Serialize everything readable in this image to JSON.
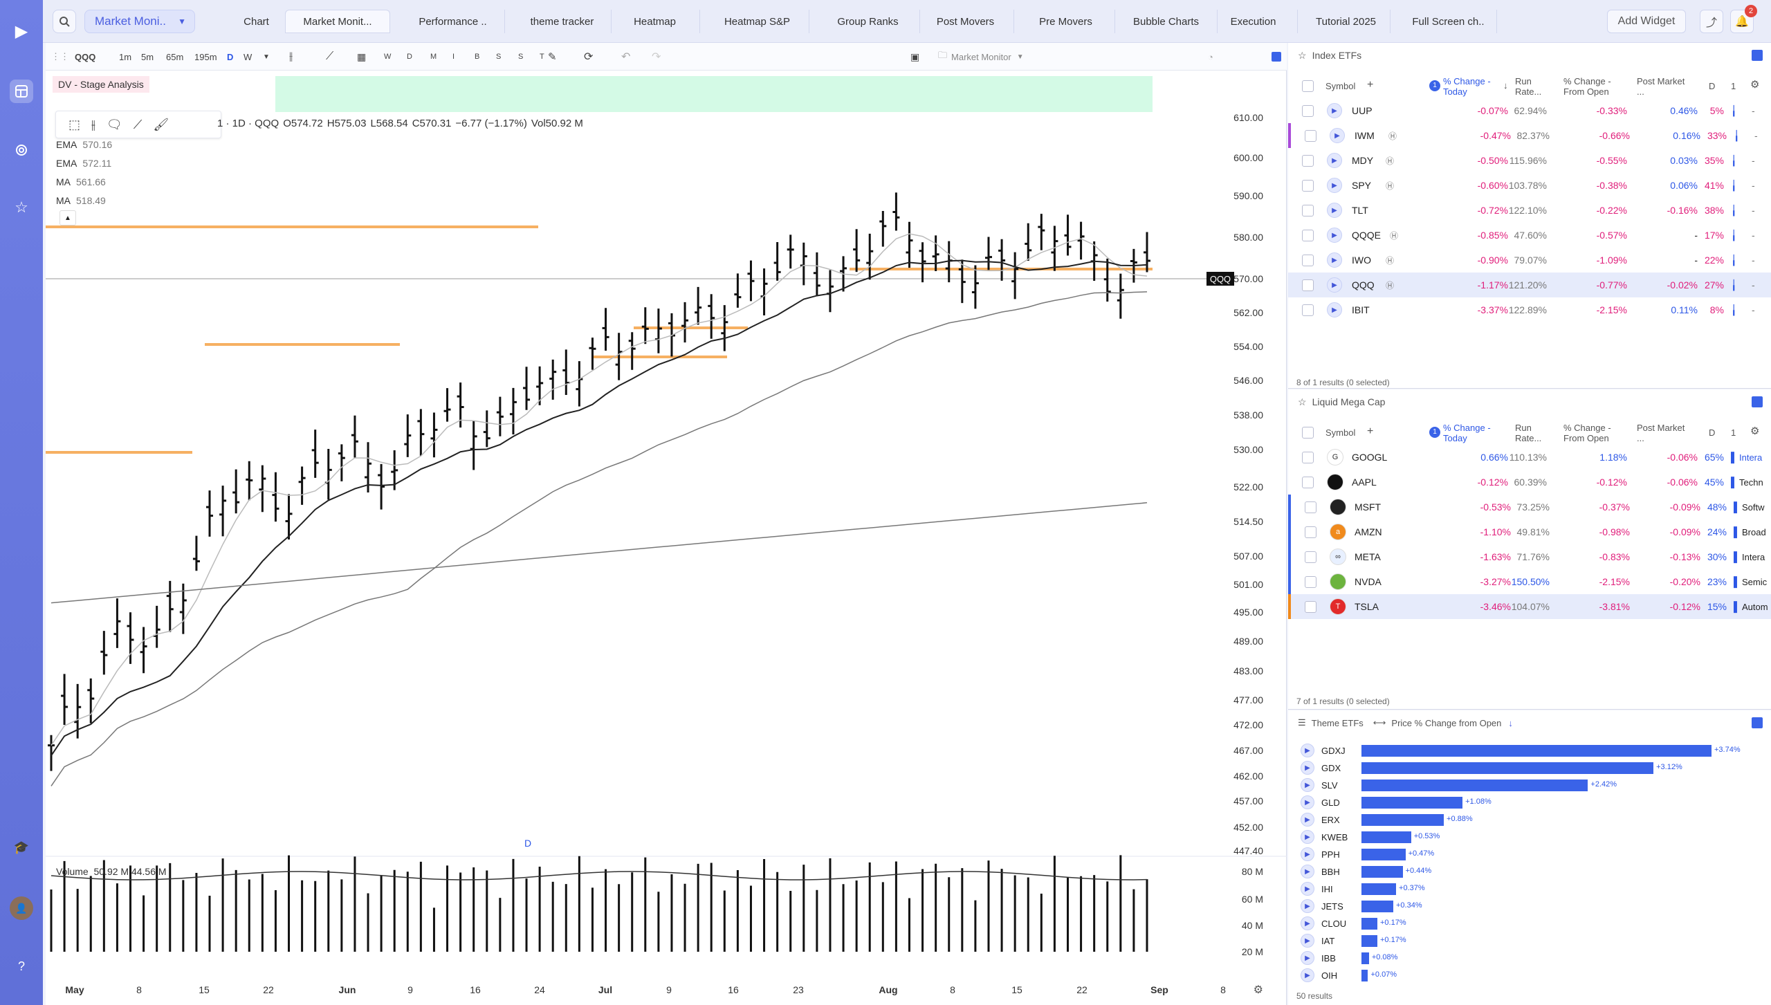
{
  "nav": {
    "workspace": "Market Moni..",
    "add_widget": "Add Widget",
    "notif_count": "2"
  },
  "tabs": [
    "Chart",
    "Market Monit...",
    "Performance ..",
    "theme tracker",
    "Heatmap",
    "Heatmap S&P",
    "Group Ranks",
    "Post Movers",
    "Pre Movers",
    "Bubble Charts",
    "Execution",
    "Tutorial 2025",
    "Full Screen ch.."
  ],
  "chart": {
    "symbol": "QQQ",
    "timeframes": [
      "1m",
      "5m",
      "65m",
      "195m",
      "D",
      "W"
    ],
    "small_btns": [
      "W",
      "D",
      "M",
      "I",
      "B",
      "S",
      "S",
      "T"
    ],
    "layout_name": "Market Monitor",
    "study_label": "DV - Stage Analysis",
    "legend_prefix": "1 · 1D · QQQ",
    "ohlc": {
      "o": "O574.72",
      "h": "H575.03",
      "l": "L568.54",
      "c": "C570.31",
      "chg": "−6.77 (−1.17%)",
      "vol": "Vol50.92 M"
    },
    "indicators": [
      {
        "name": "EMA",
        "value": "570.16"
      },
      {
        "name": "EMA",
        "value": "572.11"
      },
      {
        "name": "MA",
        "value": "561.66"
      },
      {
        "name": "MA",
        "value": "518.49"
      }
    ],
    "price_ticks": [
      "610.00",
      "600.00",
      "590.00",
      "580.00",
      "570.00",
      "562.00",
      "554.00",
      "546.00",
      "538.00",
      "530.00",
      "522.00",
      "514.50",
      "507.00",
      "501.00",
      "495.00",
      "489.00",
      "483.00",
      "477.00",
      "472.00",
      "467.00",
      "462.00",
      "457.00",
      "452.00",
      "447.40"
    ],
    "last_price": "570.00",
    "price_tag": "QQQ",
    "date_labels": [
      "May",
      "8",
      "15",
      "22",
      "Jun",
      "9",
      "16",
      "24",
      "Jul",
      "9",
      "16",
      "23",
      "Aug",
      "8",
      "15",
      "22",
      "Sep",
      "8"
    ],
    "bold_dates": [
      "May",
      "Jun",
      "Jul",
      "Aug",
      "Sep"
    ],
    "d_marker": "D",
    "volume_label": "Volume",
    "volume_vals": "50.92 M  44.56 M",
    "vol_ticks": [
      "80 M",
      "60 M",
      "40 M",
      "20 M"
    ]
  },
  "index_etfs": {
    "title": "Index ETFs",
    "headers": {
      "symbol": "Symbol",
      "change_today": "% Change - Today",
      "run_rate": "Run Rate...",
      "chg_open": "% Change - From Open",
      "post": "Post Market ...",
      "d": "D",
      "one": "1"
    },
    "rows": [
      {
        "sym": "UUP",
        "chg": "-0.07%",
        "rr": "62.94%",
        "open": "-0.33%",
        "post": "0.46%",
        "pct": "5%",
        "post_pos": true
      },
      {
        "sym": "IWM",
        "chg": "-0.47%",
        "rr": "82.37%",
        "open": "-0.66%",
        "post": "0.16%",
        "pct": "33%",
        "post_pos": true
      },
      {
        "sym": "MDY",
        "chg": "-0.50%",
        "rr": "115.96%",
        "open": "-0.55%",
        "post": "0.03%",
        "pct": "35%",
        "post_pos": true
      },
      {
        "sym": "SPY",
        "chg": "-0.60%",
        "rr": "103.78%",
        "open": "-0.38%",
        "post": "0.06%",
        "pct": "41%",
        "post_pos": true
      },
      {
        "sym": "TLT",
        "chg": "-0.72%",
        "rr": "122.10%",
        "open": "-0.22%",
        "post": "-0.16%",
        "pct": "38%",
        "post_pos": false
      },
      {
        "sym": "QQQE",
        "chg": "-0.85%",
        "rr": "47.60%",
        "open": "-0.57%",
        "post": "-",
        "pct": "17%",
        "post_pos": true
      },
      {
        "sym": "IWO",
        "chg": "-0.90%",
        "rr": "79.07%",
        "open": "-1.09%",
        "post": "-",
        "pct": "22%",
        "post_pos": true
      },
      {
        "sym": "QQQ",
        "chg": "-1.17%",
        "rr": "121.20%",
        "open": "-0.77%",
        "post": "-0.02%",
        "pct": "27%",
        "post_pos": false
      },
      {
        "sym": "IBIT",
        "chg": "-3.37%",
        "rr": "122.89%",
        "open": "-2.15%",
        "post": "0.11%",
        "pct": "8%",
        "post_pos": true
      }
    ],
    "footer": "8 of 1 results (0 selected)"
  },
  "mega_cap": {
    "title": "Liquid Mega Cap",
    "rows": [
      {
        "sym": "GOOGL",
        "chg": "0.66%",
        "rr": "110.13%",
        "open": "1.18%",
        "post": "-0.06%",
        "pct": "65%",
        "ind": "Intera",
        "pos": true,
        "logo": "G",
        "logocol": "#ffffff"
      },
      {
        "sym": "AAPL",
        "chg": "-0.12%",
        "rr": "60.39%",
        "open": "-0.12%",
        "post": "-0.06%",
        "pct": "45%",
        "ind": "Techn",
        "pos": false,
        "logo": "",
        "logocol": "#111111"
      },
      {
        "sym": "MSFT",
        "chg": "-0.53%",
        "rr": "73.25%",
        "open": "-0.37%",
        "post": "-0.09%",
        "pct": "48%",
        "ind": "Softw",
        "pos": false,
        "logo": "",
        "logocol": "#222222"
      },
      {
        "sym": "AMZN",
        "chg": "-1.10%",
        "rr": "49.81%",
        "open": "-0.98%",
        "post": "-0.09%",
        "pct": "24%",
        "ind": "Broad",
        "pos": false,
        "logo": "a",
        "logocol": "#f08a1c"
      },
      {
        "sym": "META",
        "chg": "-1.63%",
        "rr": "71.76%",
        "open": "-0.83%",
        "post": "-0.13%",
        "pct": "30%",
        "ind": "Intera",
        "pos": false,
        "logo": "∞",
        "logocol": "#e8f0ff"
      },
      {
        "sym": "NVDA",
        "chg": "-3.27%",
        "rr": "150.50%",
        "open": "-2.15%",
        "post": "-0.20%",
        "pct": "23%",
        "ind": "Semic",
        "pos": false,
        "logo": "",
        "logocol": "#6cb33e"
      },
      {
        "sym": "TSLA",
        "chg": "-3.46%",
        "rr": "104.07%",
        "open": "-3.81%",
        "post": "-0.12%",
        "pct": "15%",
        "ind": "Autom",
        "pos": false,
        "logo": "T",
        "logocol": "#e22a2a"
      }
    ],
    "footer": "7 of 1 results (0 selected)"
  },
  "theme_etfs": {
    "title": "Theme ETFs",
    "metric": "Price % Change from Open",
    "rows": [
      {
        "sym": "GDXJ",
        "val": 3.74,
        "label": "+3.74%"
      },
      {
        "sym": "GDX",
        "val": 3.12,
        "label": "+3.12%"
      },
      {
        "sym": "SLV",
        "val": 2.42,
        "label": "+2.42%"
      },
      {
        "sym": "GLD",
        "val": 1.08,
        "label": "+1.08%"
      },
      {
        "sym": "ERX",
        "val": 0.88,
        "label": "+0.88%"
      },
      {
        "sym": "KWEB",
        "val": 0.53,
        "label": "+0.53%"
      },
      {
        "sym": "PPH",
        "val": 0.47,
        "label": "+0.47%"
      },
      {
        "sym": "BBH",
        "val": 0.44,
        "label": "+0.44%"
      },
      {
        "sym": "IHI",
        "val": 0.37,
        "label": "+0.37%"
      },
      {
        "sym": "JETS",
        "val": 0.34,
        "label": "+0.34%"
      },
      {
        "sym": "CLOU",
        "val": 0.17,
        "label": "+0.17%"
      },
      {
        "sym": "IAT",
        "val": 0.17,
        "label": "+0.17%"
      },
      {
        "sym": "IBB",
        "val": 0.08,
        "label": "+0.08%"
      },
      {
        "sym": "OIH",
        "val": 0.07,
        "label": "+0.07%"
      }
    ],
    "footer": "50 results"
  },
  "colors": {
    "accent": "#5b6ee1",
    "neg": "#e01d7a",
    "pos": "#2d57e6",
    "bar": "#3a63e8",
    "sr": "#f5a347"
  }
}
